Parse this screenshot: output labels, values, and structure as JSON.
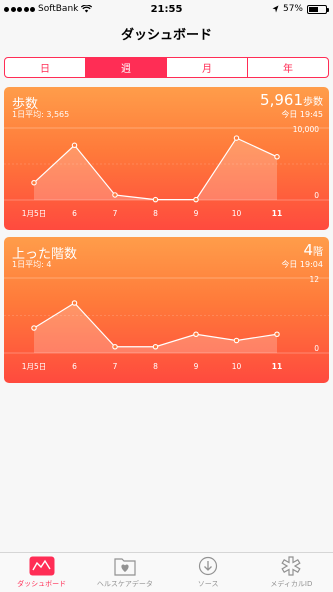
{
  "status": {
    "carrier": "SoftBank",
    "time": "21:55",
    "battery": "57%",
    "battery_level": 0.57
  },
  "nav": {
    "title": "ダッシュボード"
  },
  "segments": [
    "日",
    "週",
    "月",
    "年"
  ],
  "active_segment": 1,
  "cards": [
    {
      "title": "歩数",
      "subtitle": "1日平均: 3,565",
      "value": "5,961",
      "unit": "歩数",
      "time": "今日 19:45",
      "ymax_label": "10,000",
      "ymin_label": "0"
    },
    {
      "title": "上った階数",
      "subtitle": "1日平均: 4",
      "value": "4",
      "unit": "階",
      "time": "今日 19:04",
      "ymax_label": "12",
      "ymin_label": "0"
    }
  ],
  "chart_data": [
    {
      "type": "area",
      "categories": [
        "1月5日",
        "6",
        "7",
        "8",
        "9",
        "10",
        "11"
      ],
      "values": [
        2400,
        7600,
        700,
        50,
        50,
        8600,
        6000
      ],
      "ylim": [
        0,
        10000
      ]
    },
    {
      "type": "area",
      "categories": [
        "1月5日",
        "6",
        "7",
        "8",
        "9",
        "10",
        "11"
      ],
      "values": [
        4,
        8,
        1,
        1,
        3,
        2,
        3
      ],
      "ylim": [
        0,
        12
      ]
    }
  ],
  "tabs": [
    {
      "label": "ダッシュボード",
      "icon": "dashboard-icon"
    },
    {
      "label": "ヘルスケアデータ",
      "icon": "health-data-icon"
    },
    {
      "label": "ソース",
      "icon": "sources-icon"
    },
    {
      "label": "メディカルID",
      "icon": "medical-id-icon"
    }
  ],
  "colors": {
    "accent": "#ff2d55",
    "card_top": "#ff9d4a",
    "card_bottom": "#ff4a3e"
  }
}
